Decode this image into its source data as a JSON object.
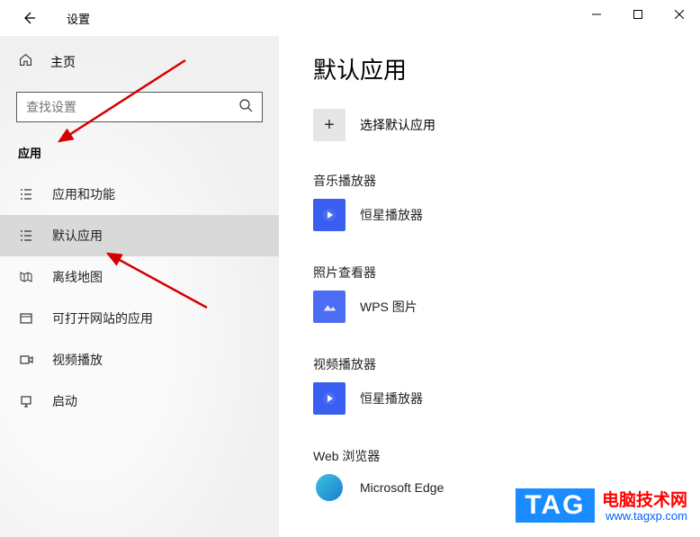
{
  "window": {
    "title": "设置"
  },
  "sidebar": {
    "home": "主页",
    "search_placeholder": "查找设置",
    "category": "应用",
    "items": [
      {
        "label": "应用和功能"
      },
      {
        "label": "默认应用"
      },
      {
        "label": "离线地图"
      },
      {
        "label": "可打开网站的应用"
      },
      {
        "label": "视频播放"
      },
      {
        "label": "启动"
      }
    ]
  },
  "main": {
    "title": "默认应用",
    "choose_label": "选择默认应用",
    "sections": [
      {
        "heading": "音乐播放器",
        "app": "恒星播放器"
      },
      {
        "heading": "照片查看器",
        "app": "WPS 图片"
      },
      {
        "heading": "视频播放器",
        "app": "恒星播放器"
      },
      {
        "heading": "Web 浏览器",
        "app": "Microsoft Edge"
      }
    ]
  },
  "badge": {
    "tag": "TAG",
    "text": "电脑技术网",
    "url": "www.tagxp.com"
  }
}
